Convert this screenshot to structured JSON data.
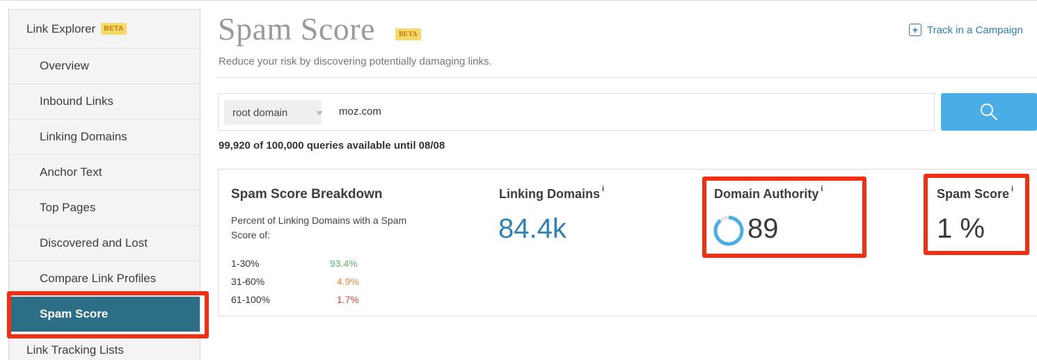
{
  "sidebar": {
    "header_label": "Link Explorer",
    "header_badge": "BETA",
    "items": [
      {
        "label": "Overview"
      },
      {
        "label": "Inbound Links"
      },
      {
        "label": "Linking Domains"
      },
      {
        "label": "Anchor Text"
      },
      {
        "label": "Top Pages"
      },
      {
        "label": "Discovered and Lost"
      },
      {
        "label": "Compare Link Profiles"
      },
      {
        "label": "Spam Score"
      },
      {
        "label": "Link Tracking Lists"
      }
    ],
    "active_item": "Spam Score"
  },
  "header": {
    "title": "Spam Score",
    "badge": "BETA",
    "subtitle": "Reduce your risk by discovering potentially damaging links.",
    "track_label": "Track in a Campaign",
    "track_icon": "plus-square-icon"
  },
  "search": {
    "scope_value": "root domain",
    "query_value": "moz.com",
    "button_icon": "search-icon",
    "quota_text": "99,920 of 100,000 queries available until 08/08"
  },
  "breakdown": {
    "title": "Spam Score Breakdown",
    "description": "Percent of Linking Domains with a Spam Score of:",
    "rows": [
      {
        "range": "1-30%",
        "value": "93.4%",
        "color": "#5cb85c"
      },
      {
        "range": "31-60%",
        "value": "4.9%",
        "color": "#f0883a"
      },
      {
        "range": "61-100%",
        "value": "1.7%",
        "color": "#e8382f"
      }
    ]
  },
  "metrics": {
    "linking_domains": {
      "label": "Linking Domains",
      "info": "i",
      "value": "84.4k"
    },
    "domain_authority": {
      "label": "Domain Authority",
      "info": "i",
      "value": "89",
      "ring_fraction": 0.89,
      "ring_color": "#4aaee6"
    },
    "spam_score": {
      "label": "Spam Score",
      "info": "i",
      "value": "1 %"
    }
  },
  "colors": {
    "accent": "#2d6e87",
    "link": "#2d7fb8",
    "highlight": "#f42e13",
    "search_button": "#4aaee6"
  }
}
